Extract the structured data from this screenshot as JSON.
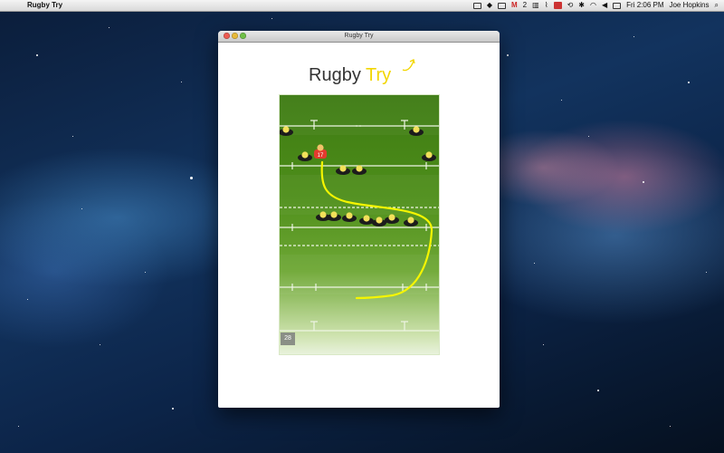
{
  "menubar": {
    "app_name": "Rugby Try",
    "gmail_count": "2",
    "clock": "Fri 2:06 PM",
    "user": "Joe Hopkins"
  },
  "window": {
    "title": "Rugby Try",
    "logo_text_1": "Rugby",
    "logo_text_2": "Try"
  },
  "game": {
    "counter": "28",
    "player_number": "17",
    "colors": {
      "pitch": "#4f8f1b",
      "path": "#f5f500",
      "attacker": "#e23b2e",
      "defender": "#1c1c1c",
      "helmet": "#f2e05a"
    }
  }
}
